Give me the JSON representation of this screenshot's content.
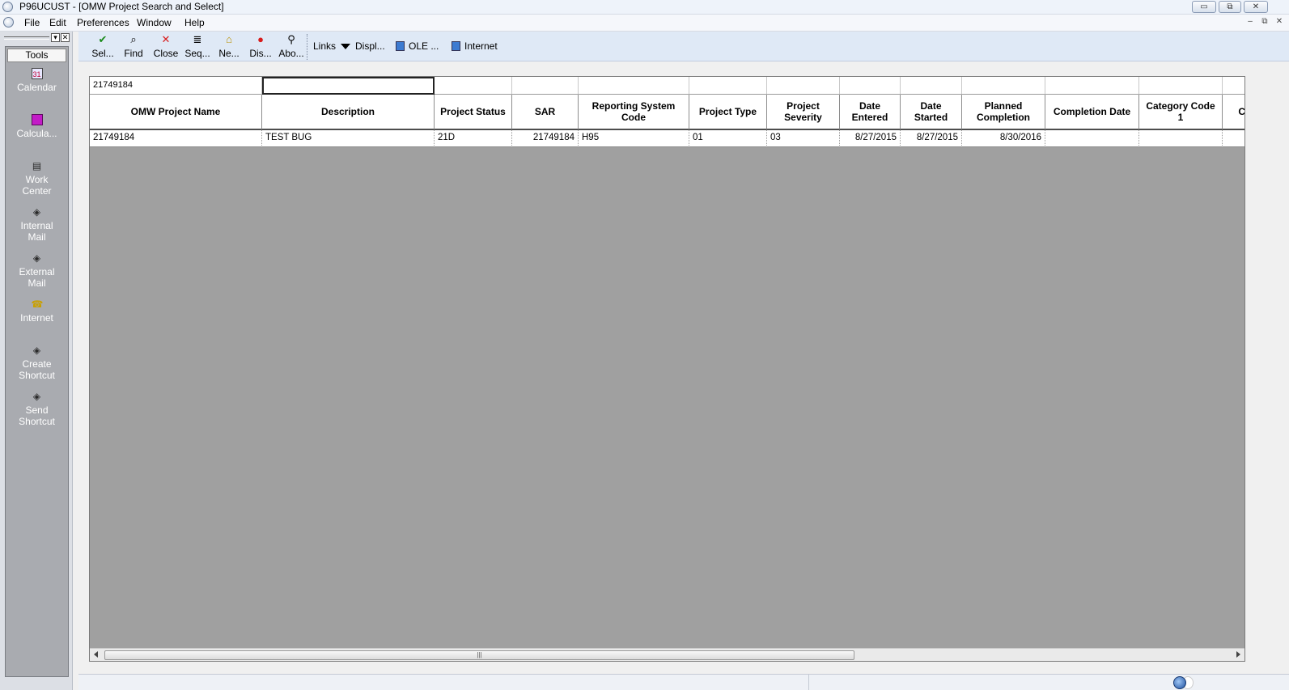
{
  "window": {
    "title": "P96UCUST - [OMW Project Search and Select]",
    "controls": {
      "minimize": "▭",
      "restore": "⧉",
      "close": "✕"
    }
  },
  "menu": {
    "items": [
      "File",
      "Edit",
      "Preferences",
      "Window",
      "Help"
    ],
    "mdi_controls": {
      "minimize": "–",
      "restore": "⧉",
      "close": "✕"
    }
  },
  "tools_pane": {
    "header": "Tools",
    "items": [
      {
        "label": "Calendar",
        "icon": "calendar-icon"
      },
      {
        "label": "Calcula...",
        "icon": "calculator-icon"
      },
      {
        "label": "Work Center",
        "icon": "work-center-icon"
      },
      {
        "label": "Internal Mail",
        "icon": "internal-mail-icon"
      },
      {
        "label": "External Mail",
        "icon": "external-mail-icon"
      },
      {
        "label": "Internet",
        "icon": "internet-icon"
      },
      {
        "label": "Create Shortcut",
        "icon": "create-shortcut-icon"
      },
      {
        "label": "Send Shortcut",
        "icon": "send-shortcut-icon"
      }
    ]
  },
  "toolbar": {
    "buttons": [
      {
        "label": "Sel...",
        "icon": "checkmark-icon",
        "color": "#1a8a1a"
      },
      {
        "label": "Find",
        "icon": "find-icon",
        "color": "#222222"
      },
      {
        "label": "Close",
        "icon": "close-x-icon",
        "color": "#d81c1c"
      },
      {
        "label": "Seq...",
        "icon": "sequence-icon",
        "color": "#222222"
      },
      {
        "label": "Ne...",
        "icon": "new-icon",
        "color": "#222222"
      },
      {
        "label": "Dis...",
        "icon": "display-icon",
        "color": "#d81c1c"
      },
      {
        "label": "Abo...",
        "icon": "about-icon",
        "color": "#222222"
      }
    ],
    "links_label": "Links",
    "display_label": "Displ...",
    "ole_label": "OLE ...",
    "internet_label": "Internet"
  },
  "grid": {
    "qbe": [
      "21749184",
      "",
      "",
      "",
      "",
      "",
      "",
      "",
      "",
      "",
      "",
      "",
      ""
    ],
    "columns": [
      "OMW Project Name",
      "Description",
      "Project Status",
      "SAR",
      "Reporting System Code",
      "Project Type",
      "Project Severity",
      "Date Entered",
      "Date Started",
      "Planned Completion",
      "Completion Date",
      "Category Code 1",
      "C"
    ],
    "rows": [
      [
        "21749184",
        "TEST BUG",
        "21D",
        "21749184",
        "H95",
        "01",
        "03",
        "8/27/2015",
        "8/27/2015",
        "8/30/2016",
        "",
        "",
        ""
      ]
    ]
  },
  "scrollbar": {
    "thumb_grip": "|||"
  }
}
